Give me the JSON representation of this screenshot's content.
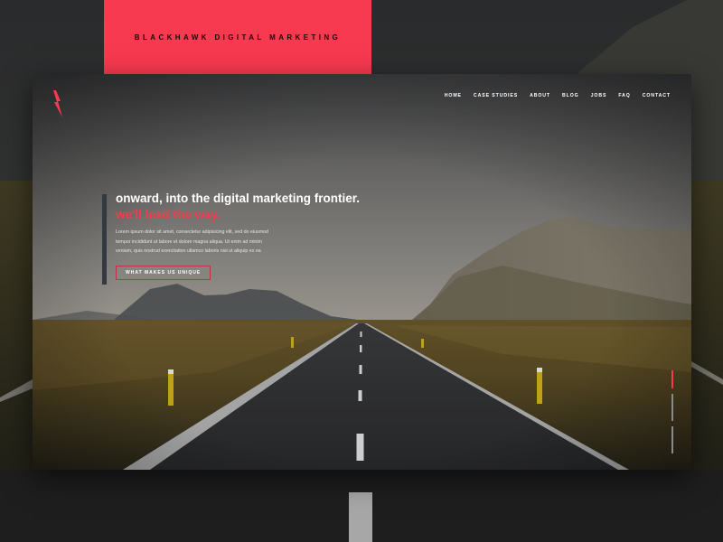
{
  "brand": {
    "banner_text": "BLACKHAWK DIGITAL MARKETING"
  },
  "nav": {
    "items": [
      {
        "label": "HOME"
      },
      {
        "label": "CASE STUDIES"
      },
      {
        "label": "ABOUT"
      },
      {
        "label": "BLOG"
      },
      {
        "label": "JOBS"
      },
      {
        "label": "FAQ"
      },
      {
        "label": "CONTACT"
      }
    ]
  },
  "hero": {
    "headline": "onward, into the digital marketing frontier.",
    "tagline": "we'll lead the way.",
    "body_lines": [
      "Lorem ipsum dolor sit amet, consectetur adipisicing elit, sed do eiusmod",
      "tempor incididunt ut labore et dolore magna aliqua. Ut enim ad minim",
      "veniam, quis nostrud exercitation ullamco laboris nisi ut aliquip ex ea"
    ],
    "cta_label": "WHAT MAKES US UNIQUE"
  },
  "colors": {
    "accent": "#f73a4f",
    "dark": "#1e1f20",
    "text": "#ffffff"
  },
  "icons": {
    "logo": "lightning-bolt-icon"
  },
  "slider": {
    "active_index": 0,
    "total": 3
  }
}
